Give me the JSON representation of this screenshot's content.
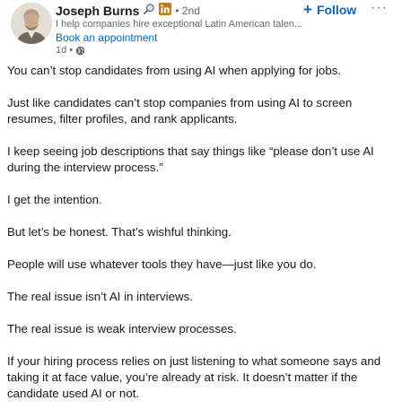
{
  "author": {
    "name": "Joseph Burns",
    "degree": "• 2nd",
    "headline": "I help companies hire exceptional Latin American talen...",
    "cta": "Book an appointment",
    "time": "1d •"
  },
  "actions": {
    "follow_label": "Follow",
    "more_label": "···"
  },
  "post": {
    "paragraphs": [
      "You can’t stop candidates from using AI when applying for jobs.",
      "Just like candidates can’t stop companies from using AI to screen resumes, filter profiles, and rank applicants.",
      "I keep seeing job descriptions that say things like “please don’t use AI during the interview process.”",
      "I get the intention.",
      "But let’s be honest. That’s wishful thinking.",
      "People will use whatever tools they have—just like you do.",
      "The real issue isn’t AI in interviews.",
      "The real issue is weak interview processes.",
      "If your hiring process relies on just listening to what someone says and taking it at face value, you’re already at risk. It doesn’t matter if the candidate used AI or not."
    ]
  },
  "icons": [
    "search-icon",
    "linkedin-premium-icon",
    "globe-icon",
    "plus-icon",
    "more-icon"
  ],
  "colors": {
    "link": "#0a66c2",
    "premium": "#c37d16",
    "text": "#191919",
    "muted": "#666666"
  }
}
